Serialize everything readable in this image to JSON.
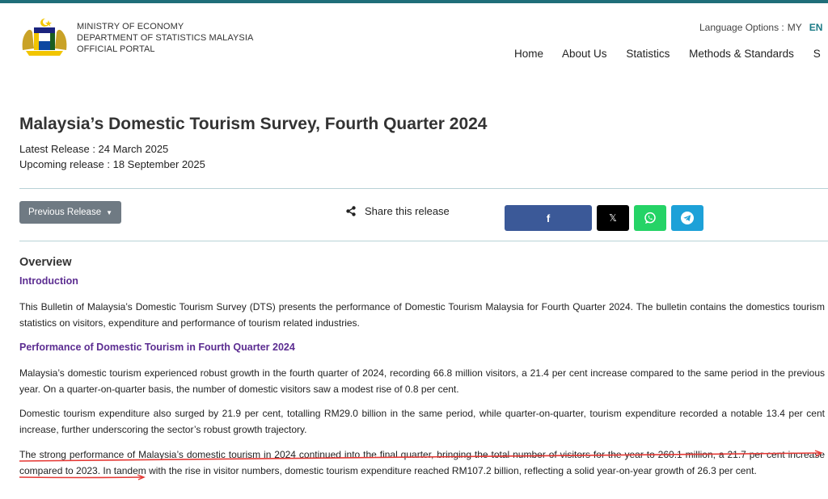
{
  "header": {
    "org_lines": [
      "MINISTRY OF ECONOMY",
      "DEPARTMENT OF STATISTICS MALAYSIA",
      "OFFICIAL PORTAL"
    ],
    "language_label": "Language Options :",
    "language_my": "MY",
    "language_en": "EN",
    "nav": [
      "Home",
      "About Us",
      "Statistics",
      "Methods & Standards",
      "S"
    ]
  },
  "page": {
    "title": "Malaysia’s Domestic Tourism Survey, Fourth Quarter 2024",
    "latest_release": "Latest Release : 24 March 2025",
    "upcoming_release": "Upcoming release : 18 September 2025"
  },
  "share": {
    "previous_release_label": "Previous Release",
    "share_label": "Share this release",
    "buttons": [
      {
        "name": "facebook",
        "glyph": "f",
        "color": "#3b5998"
      },
      {
        "name": "x",
        "glyph": "𝕏",
        "color": "#000000"
      },
      {
        "name": "whatsapp",
        "glyph": "",
        "color": "#25d366"
      },
      {
        "name": "telegram",
        "glyph": "",
        "color": "#1da1d8"
      }
    ]
  },
  "content": {
    "overview_heading": "Overview",
    "introduction_heading": "Introduction",
    "intro_paragraph": "This Bulletin of Malaysia’s Domestic Tourism Survey (DTS) presents the performance of Domestic Tourism Malaysia for Fourth Quarter 2024. The bulletin contains the domestics tourism statistics on visitors, expenditure and performance of tourism related industries.",
    "performance_heading": "Performance of Domestic Tourism in Fourth Quarter 2024",
    "paragraphs": [
      "Malaysia’s domestic tourism experienced robust growth in the fourth quarter of 2024, recording 66.8 million visitors, a 21.4 per cent increase compared to the same period in the previous year. On a quarter-on-quarter basis, the number of domestic visitors saw a modest rise of 0.8 per cent.",
      "Domestic tourism expenditure also surged by 21.9 per cent, totalling RM29.0 billion in the same period, while quarter-on-quarter, tourism expenditure recorded a notable 13.4 per cent increase, further underscoring the sector’s robust growth trajectory.",
      "The strong performance of Malaysia’s domestic tourism in 2024 continued into the final quarter, bringing the total number of visitors for the year to 260.1 million, a 21.7 per cent increase compared to 2023. In tandem with the rise in visitor numbers, domestic tourism expenditure reached RM107.2 billion, reflecting a solid year-on-year growth of 26.3 per cent."
    ]
  },
  "colors": {
    "accent": "#1f6e79",
    "subheading": "#5c2d91",
    "annotation": "#e53935"
  }
}
